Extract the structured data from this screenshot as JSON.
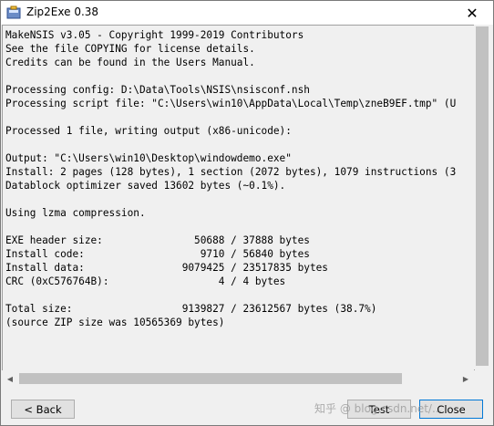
{
  "window": {
    "title": "Zip2Exe 0.38",
    "close_glyph": "✕"
  },
  "log": {
    "lines": [
      "MakeNSIS v3.05 - Copyright 1999-2019 Contributors",
      "See the file COPYING for license details.",
      "Credits can be found in the Users Manual.",
      "",
      "Processing config: D:\\Data\\Tools\\NSIS\\nsisconf.nsh",
      "Processing script file: \"C:\\Users\\win10\\AppData\\Local\\Temp\\zneB9EF.tmp\" (U",
      "",
      "Processed 1 file, writing output (x86-unicode):",
      "",
      "Output: \"C:\\Users\\win10\\Desktop\\windowdemo.exe\"",
      "Install: 2 pages (128 bytes), 1 section (2072 bytes), 1079 instructions (3",
      "Datablock optimizer saved 13602 bytes (~0.1%).",
      "",
      "Using lzma compression.",
      "",
      "EXE header size:               50688 / 37888 bytes",
      "Install code:                   9710 / 56840 bytes",
      "Install data:                9079425 / 23517835 bytes",
      "CRC (0xC576764B):                  4 / 4 bytes",
      "",
      "Total size:                  9139827 / 23612567 bytes (38.7%)",
      "(source ZIP size was 10565369 bytes)"
    ]
  },
  "scrollbar": {
    "left_arrow": "◀",
    "right_arrow": "▶"
  },
  "buttons": {
    "back": "< Back",
    "test": "Test",
    "close": "Close"
  },
  "watermark": "知乎 @ blog.csdn.net/..."
}
